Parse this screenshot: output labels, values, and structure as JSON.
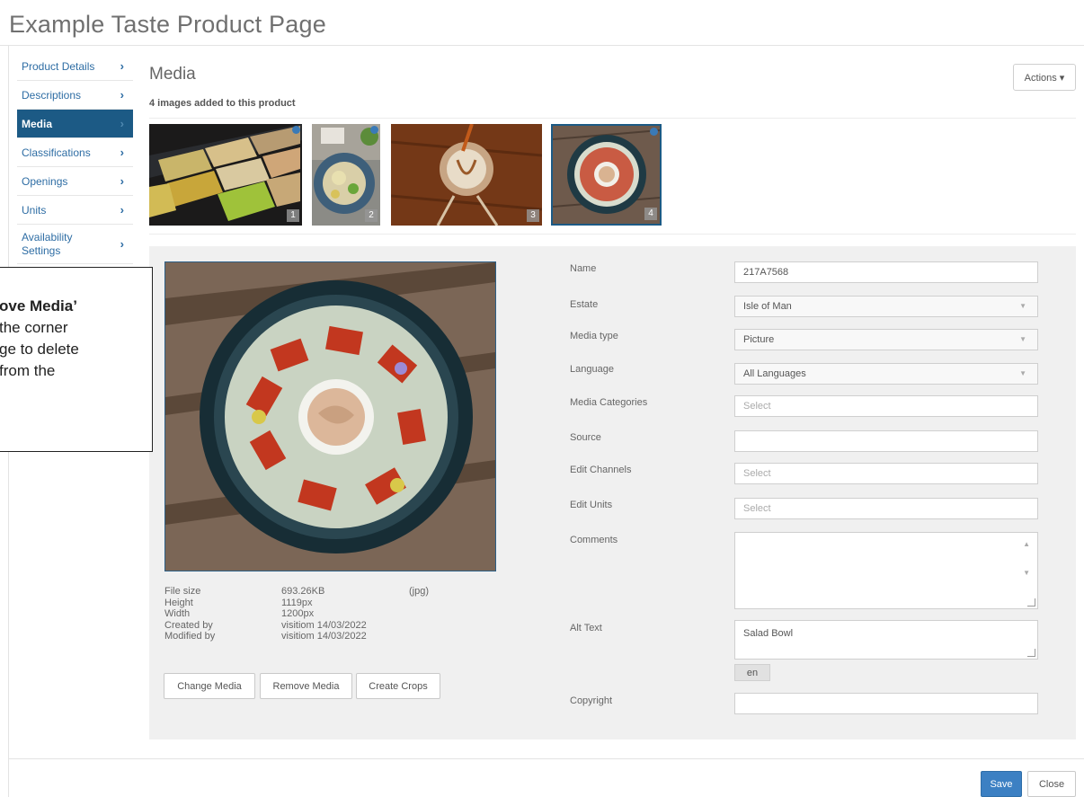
{
  "page": {
    "title": "Example Taste Product Page"
  },
  "sidebar": {
    "items": [
      {
        "label": "Product Details",
        "active": false
      },
      {
        "label": "Descriptions",
        "active": false
      },
      {
        "label": "Media",
        "active": true
      },
      {
        "label": "Classifications",
        "active": false
      },
      {
        "label": "Openings",
        "active": false
      },
      {
        "label": "Units",
        "active": false
      },
      {
        "label": "Availability Settings",
        "active": false
      }
    ],
    "chevron": "›",
    "icon": "chevron-right-icon"
  },
  "media": {
    "heading": "Media",
    "subtitle": "4 images added to this product",
    "actions_label": "Actions ▾",
    "thumbnails": [
      {
        "number": "1",
        "selected": false
      },
      {
        "number": "2",
        "selected": false
      },
      {
        "number": "3",
        "selected": false
      },
      {
        "number": "4",
        "selected": true
      }
    ]
  },
  "file_info": {
    "rows": [
      {
        "key": "File size",
        "value": "693.26KB",
        "extra": "(jpg)"
      },
      {
        "key": "Height",
        "value": "1119px",
        "extra": ""
      },
      {
        "key": "Width",
        "value": "1200px",
        "extra": ""
      },
      {
        "key": "Created by",
        "value": "visitiom 14/03/2022",
        "extra": ""
      },
      {
        "key": "Modified by",
        "value": "visitiom 14/03/2022",
        "extra": ""
      }
    ]
  },
  "buttons": {
    "change_media": "Change Media",
    "remove_media": "Remove Media",
    "create_crops": "Create Crops",
    "save": "Save",
    "close": "Close"
  },
  "form": {
    "name": {
      "label": "Name",
      "value": "217A7568"
    },
    "estate": {
      "label": "Estate",
      "value": "Isle of Man"
    },
    "media_type": {
      "label": "Media type",
      "value": "Picture"
    },
    "language": {
      "label": "Language",
      "value": "All Languages"
    },
    "media_categories": {
      "label": "Media Categories",
      "placeholder": "Select"
    },
    "source": {
      "label": "Source",
      "value": ""
    },
    "edit_channels": {
      "label": "Edit Channels",
      "placeholder": "Select"
    },
    "edit_units": {
      "label": "Edit Units",
      "placeholder": "Select"
    },
    "comments": {
      "label": "Comments",
      "value": ""
    },
    "alt_text": {
      "label": "Alt Text",
      "value": "Salad Bowl",
      "lang": "en"
    },
    "copyright": {
      "label": "Copyright",
      "value": ""
    }
  },
  "callout": {
    "lines": [
      "ove Media’",
      " the corner",
      "ge to delete",
      "from the"
    ]
  },
  "colors": {
    "nav_active": "#1c5a85",
    "link": "#2e6da4",
    "save": "#3c80c3"
  }
}
